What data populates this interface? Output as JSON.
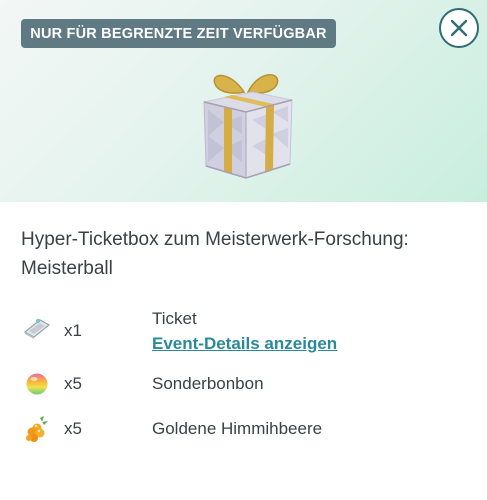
{
  "banner": {
    "label": "NUR FÜR BEGRENZTE ZEIT VERFÜGBAR"
  },
  "item": {
    "title": "Hyper-Ticketbox zum Meisterwerk-Forschung: Meisterball"
  },
  "rewards": [
    {
      "icon": "ticket-icon",
      "quantity": "x1",
      "name": "Ticket",
      "link": "Event-Details anzeigen"
    },
    {
      "icon": "rare-candy-icon",
      "quantity": "x5",
      "name": "Sonderbonbon"
    },
    {
      "icon": "golden-razz-berry-icon",
      "quantity": "x5",
      "name": "Goldene Himmihbeere"
    }
  ],
  "colors": {
    "badge_bg": "#5f7a82",
    "link": "#2a8a9a",
    "close_border": "#2f6b78"
  }
}
